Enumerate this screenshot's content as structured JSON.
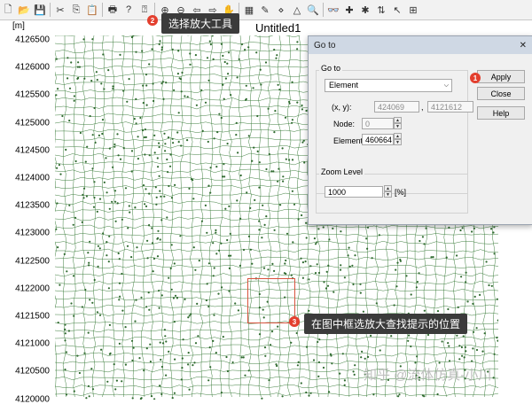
{
  "toolbar": {
    "icons": [
      "new-file",
      "open-folder",
      "save",
      "cut",
      "copy",
      "paste",
      "print",
      "help",
      "context-help",
      "zoom-in",
      "zoom-out",
      "pan-left",
      "pan-right",
      "hand-pan",
      "grid-select",
      "draw-tool",
      "select-node",
      "select-element",
      "search",
      "binoculars",
      "marker-red",
      "marker-color",
      "sort",
      "select-arrow",
      "arrange"
    ]
  },
  "view": {
    "unit_label": "[m]",
    "title": "Untitled1",
    "y_ticks": [
      "4126500",
      "4126000",
      "4125500",
      "4125000",
      "4124500",
      "4124000",
      "4123500",
      "4123000",
      "4122500",
      "4122000",
      "4121500",
      "4121000",
      "4120500",
      "4120000"
    ]
  },
  "dialog": {
    "title": "Go to",
    "close_glyph": "✕",
    "goto_group_label": "Go to",
    "type_selected": "Element",
    "xy_label": "(x, y):",
    "x_value": "424069",
    "separator": ",",
    "y_value": "4121612",
    "node_label": "Node:",
    "node_value": "0",
    "element_label": "Element:",
    "element_value": "460664",
    "zoom_group_label": "Zoom Level",
    "zoom_value": "1000",
    "zoom_unit": "[%]",
    "apply_label": "Apply",
    "close_label": "Close",
    "help_label": "Help"
  },
  "annotations": {
    "step1_number": "1",
    "step2_number": "2",
    "step2_text": "选择放大工具",
    "step3_number": "3",
    "step3_text": "在图中框选放大查找提示的位置"
  },
  "watermark": "知乎 @流体仿真-小川",
  "colors": {
    "mesh_green": "#3f7f3f",
    "highlight_red": "#d9533e",
    "badge_red": "#e33f2e",
    "callout_bg": "#3b3b3b"
  }
}
